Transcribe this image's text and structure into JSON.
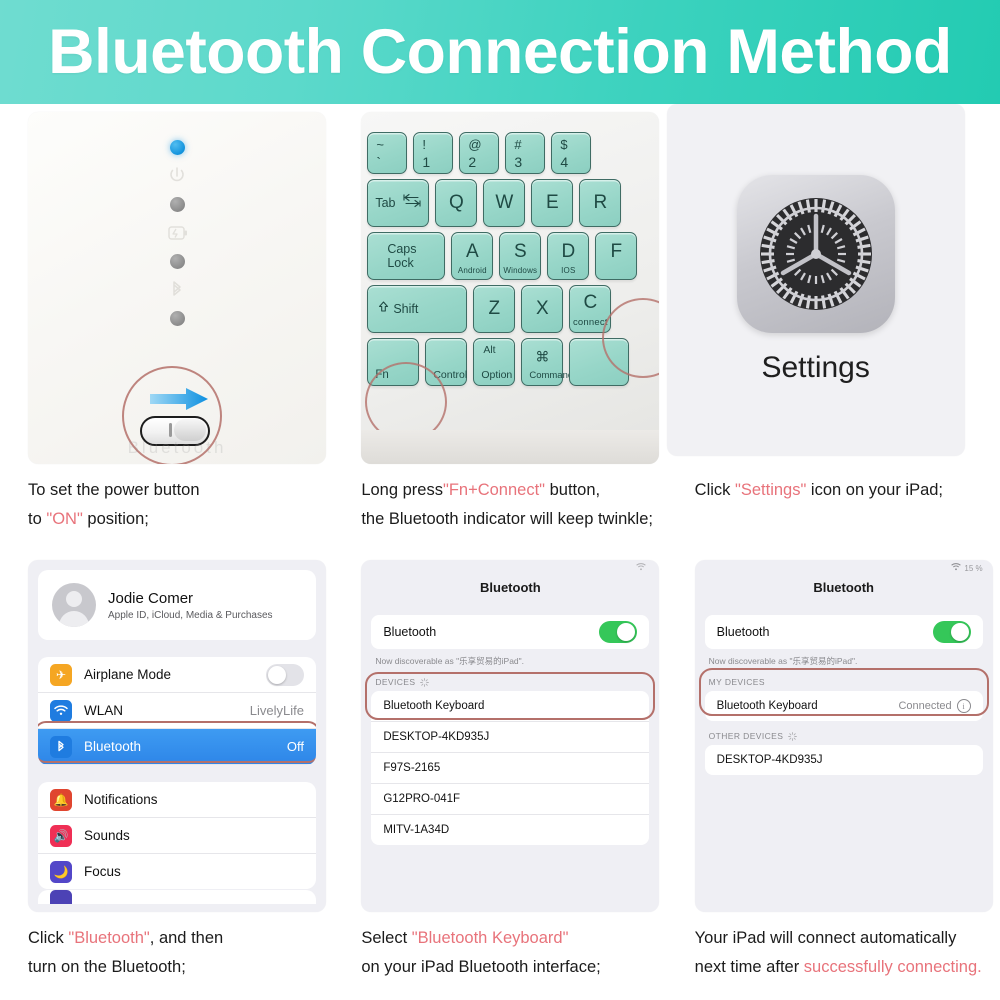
{
  "header": {
    "title": "Bluetooth Connection Method"
  },
  "panel1": {
    "name": "keyboard-power-switch",
    "leds": [
      "blue",
      "gray",
      "gray",
      "gray"
    ],
    "embossed_icons": [
      "power-icon",
      "battery-icon",
      "bluetooth-icon"
    ],
    "switch_state": "ON",
    "arrow_direction": "right",
    "brand_ghost": "Bluetooth"
  },
  "panel2": {
    "name": "keyboard-keys",
    "rows": [
      [
        {
          "top": "~",
          "bottom": "`",
          "type": "dual"
        },
        {
          "top": "!",
          "bottom": "1",
          "type": "dual"
        },
        {
          "top": "@",
          "bottom": "2",
          "type": "dual"
        },
        {
          "top": "#",
          "bottom": "3",
          "type": "dual"
        },
        {
          "top": "$",
          "bottom": "4",
          "type": "dual"
        }
      ],
      [
        {
          "label": "Tab",
          "type": "tab"
        },
        {
          "label": "Q",
          "type": "letter"
        },
        {
          "label": "W",
          "type": "letter"
        },
        {
          "label": "E",
          "type": "letter"
        },
        {
          "label": "R",
          "type": "letter"
        }
      ],
      [
        {
          "label": "Caps Lock",
          "type": "wide"
        },
        {
          "label": "A",
          "sub": "Android",
          "type": "letter"
        },
        {
          "label": "S",
          "sub": "Windows",
          "type": "letter"
        },
        {
          "label": "D",
          "sub": "IOS",
          "type": "letter"
        },
        {
          "label": "F",
          "type": "letter"
        }
      ],
      [
        {
          "label": "Shift",
          "type": "shift"
        },
        {
          "label": "Z",
          "type": "letter"
        },
        {
          "label": "X",
          "type": "letter"
        },
        {
          "label": "C",
          "sub": "connect",
          "type": "letter",
          "highlighted": true
        }
      ],
      [
        {
          "label": "Fn",
          "type": "fn",
          "highlighted": true
        },
        {
          "label": "Control",
          "type": "mod"
        },
        {
          "top": "Alt",
          "bottom": "Option",
          "type": "mod2"
        },
        {
          "glyph": "⌘",
          "bottom": "Command",
          "type": "mod2"
        },
        {
          "label": "",
          "type": "space"
        }
      ]
    ],
    "highlight_keys": [
      "Fn",
      "C"
    ]
  },
  "panel3": {
    "name": "settings-app-icon",
    "icon": "gear-icon",
    "label": "Settings"
  },
  "panel4": {
    "name": "ios-settings-list",
    "account": {
      "name": "Jodie Comer",
      "subtitle": "Apple ID, iCloud, Media & Purchases",
      "avatar": "person-avatar-icon"
    },
    "group1": [
      {
        "label": "Airplane Mode",
        "icon": "airplane-icon",
        "icon_color": "#f5a623",
        "control": "toggle",
        "toggle_on": false
      },
      {
        "label": "WLAN",
        "icon": "wifi-icon",
        "icon_color": "#1f7ce0",
        "value": "LivelyLife"
      },
      {
        "label": "Bluetooth",
        "icon": "bluetooth-icon",
        "icon_color": "#1f7ce0",
        "value": "Off",
        "selected": true
      }
    ],
    "group2": [
      {
        "label": "Notifications",
        "icon": "bell-icon",
        "icon_color": "#e0452f"
      },
      {
        "label": "Sounds",
        "icon": "speaker-icon",
        "icon_color": "#ef2f55"
      },
      {
        "label": "Focus",
        "icon": "moon-icon",
        "icon_color": "#5347c8"
      }
    ],
    "partial_item": {
      "icon": "screen-time-icon",
      "icon_color": "#4c42b5"
    },
    "highlight_color": "#b4706a"
  },
  "panel5": {
    "name": "bluetooth-scanning-screen",
    "statusbar": {
      "wifi": "wifi-icon",
      "battery": ""
    },
    "title": "Bluetooth",
    "toggle_label": "Bluetooth",
    "toggle_on": true,
    "note": "Now discoverable as \"乐享贸易的iPad\".",
    "section_header": "DEVICES",
    "devices": [
      {
        "name": "Bluetooth Keyboard",
        "highlighted": true
      },
      {
        "name": "DESKTOP-4KD935J"
      },
      {
        "name": "F97S-2165"
      },
      {
        "name": "G12PRO-041F"
      },
      {
        "name": "MITV-1A34D"
      }
    ]
  },
  "panel6": {
    "name": "bluetooth-connected-screen",
    "statusbar": {
      "wifi": "wifi-icon",
      "battery": "15 %"
    },
    "title": "Bluetooth",
    "toggle_label": "Bluetooth",
    "toggle_on": true,
    "note": "Now discoverable as \"乐享贸易的iPad\".",
    "my_devices_header": "MY DEVICES",
    "my_devices": [
      {
        "name": "Bluetooth Keyboard",
        "status": "Connected",
        "info": "info-icon",
        "highlighted": true
      }
    ],
    "other_devices_header": "OTHER DEVICES",
    "other_devices": [
      {
        "name": "DESKTOP-4KD935J"
      }
    ]
  },
  "captions": {
    "c1_line1": "To set the power button",
    "c1_line2_pre": "to ",
    "c1_line2_hl": "\"ON\"",
    "c1_line2_post": " position;",
    "c2_line1_pre": "Long press",
    "c2_line1_hl": "\"Fn+Connect\"",
    "c2_line1_post": " button,",
    "c2_line2": "the Bluetooth indicator will keep twinkle;",
    "c3_line1_pre": "Click ",
    "c3_line1_hl": "\"Settings\"",
    "c3_line1_post": " icon on your iPad;",
    "c4_line1_pre": "Click ",
    "c4_line1_hl": "\"Bluetooth\"",
    "c4_line1_post": ", and then",
    "c4_line2": "turn on the Bluetooth;",
    "c5_line1_pre": "Select ",
    "c5_line1_hl": "\"Bluetooth Keyboard\"",
    "c5_line2": "on your iPad Bluetooth interface;",
    "c6_line1": "Your iPad will connect automatically",
    "c6_line2_pre": "next time after ",
    "c6_line2_hl": "successfully connecting."
  },
  "colors": {
    "header_gradient_start": "#6FDCD0",
    "header_gradient_end": "#23CBB2",
    "highlight_red": "#e8737b",
    "annotation_circle": "#b4706a",
    "ios_blue": "#2e86e8",
    "ios_green": "#35c759",
    "key_mint": "#97d6c8",
    "led_blue": "#1293dd"
  }
}
